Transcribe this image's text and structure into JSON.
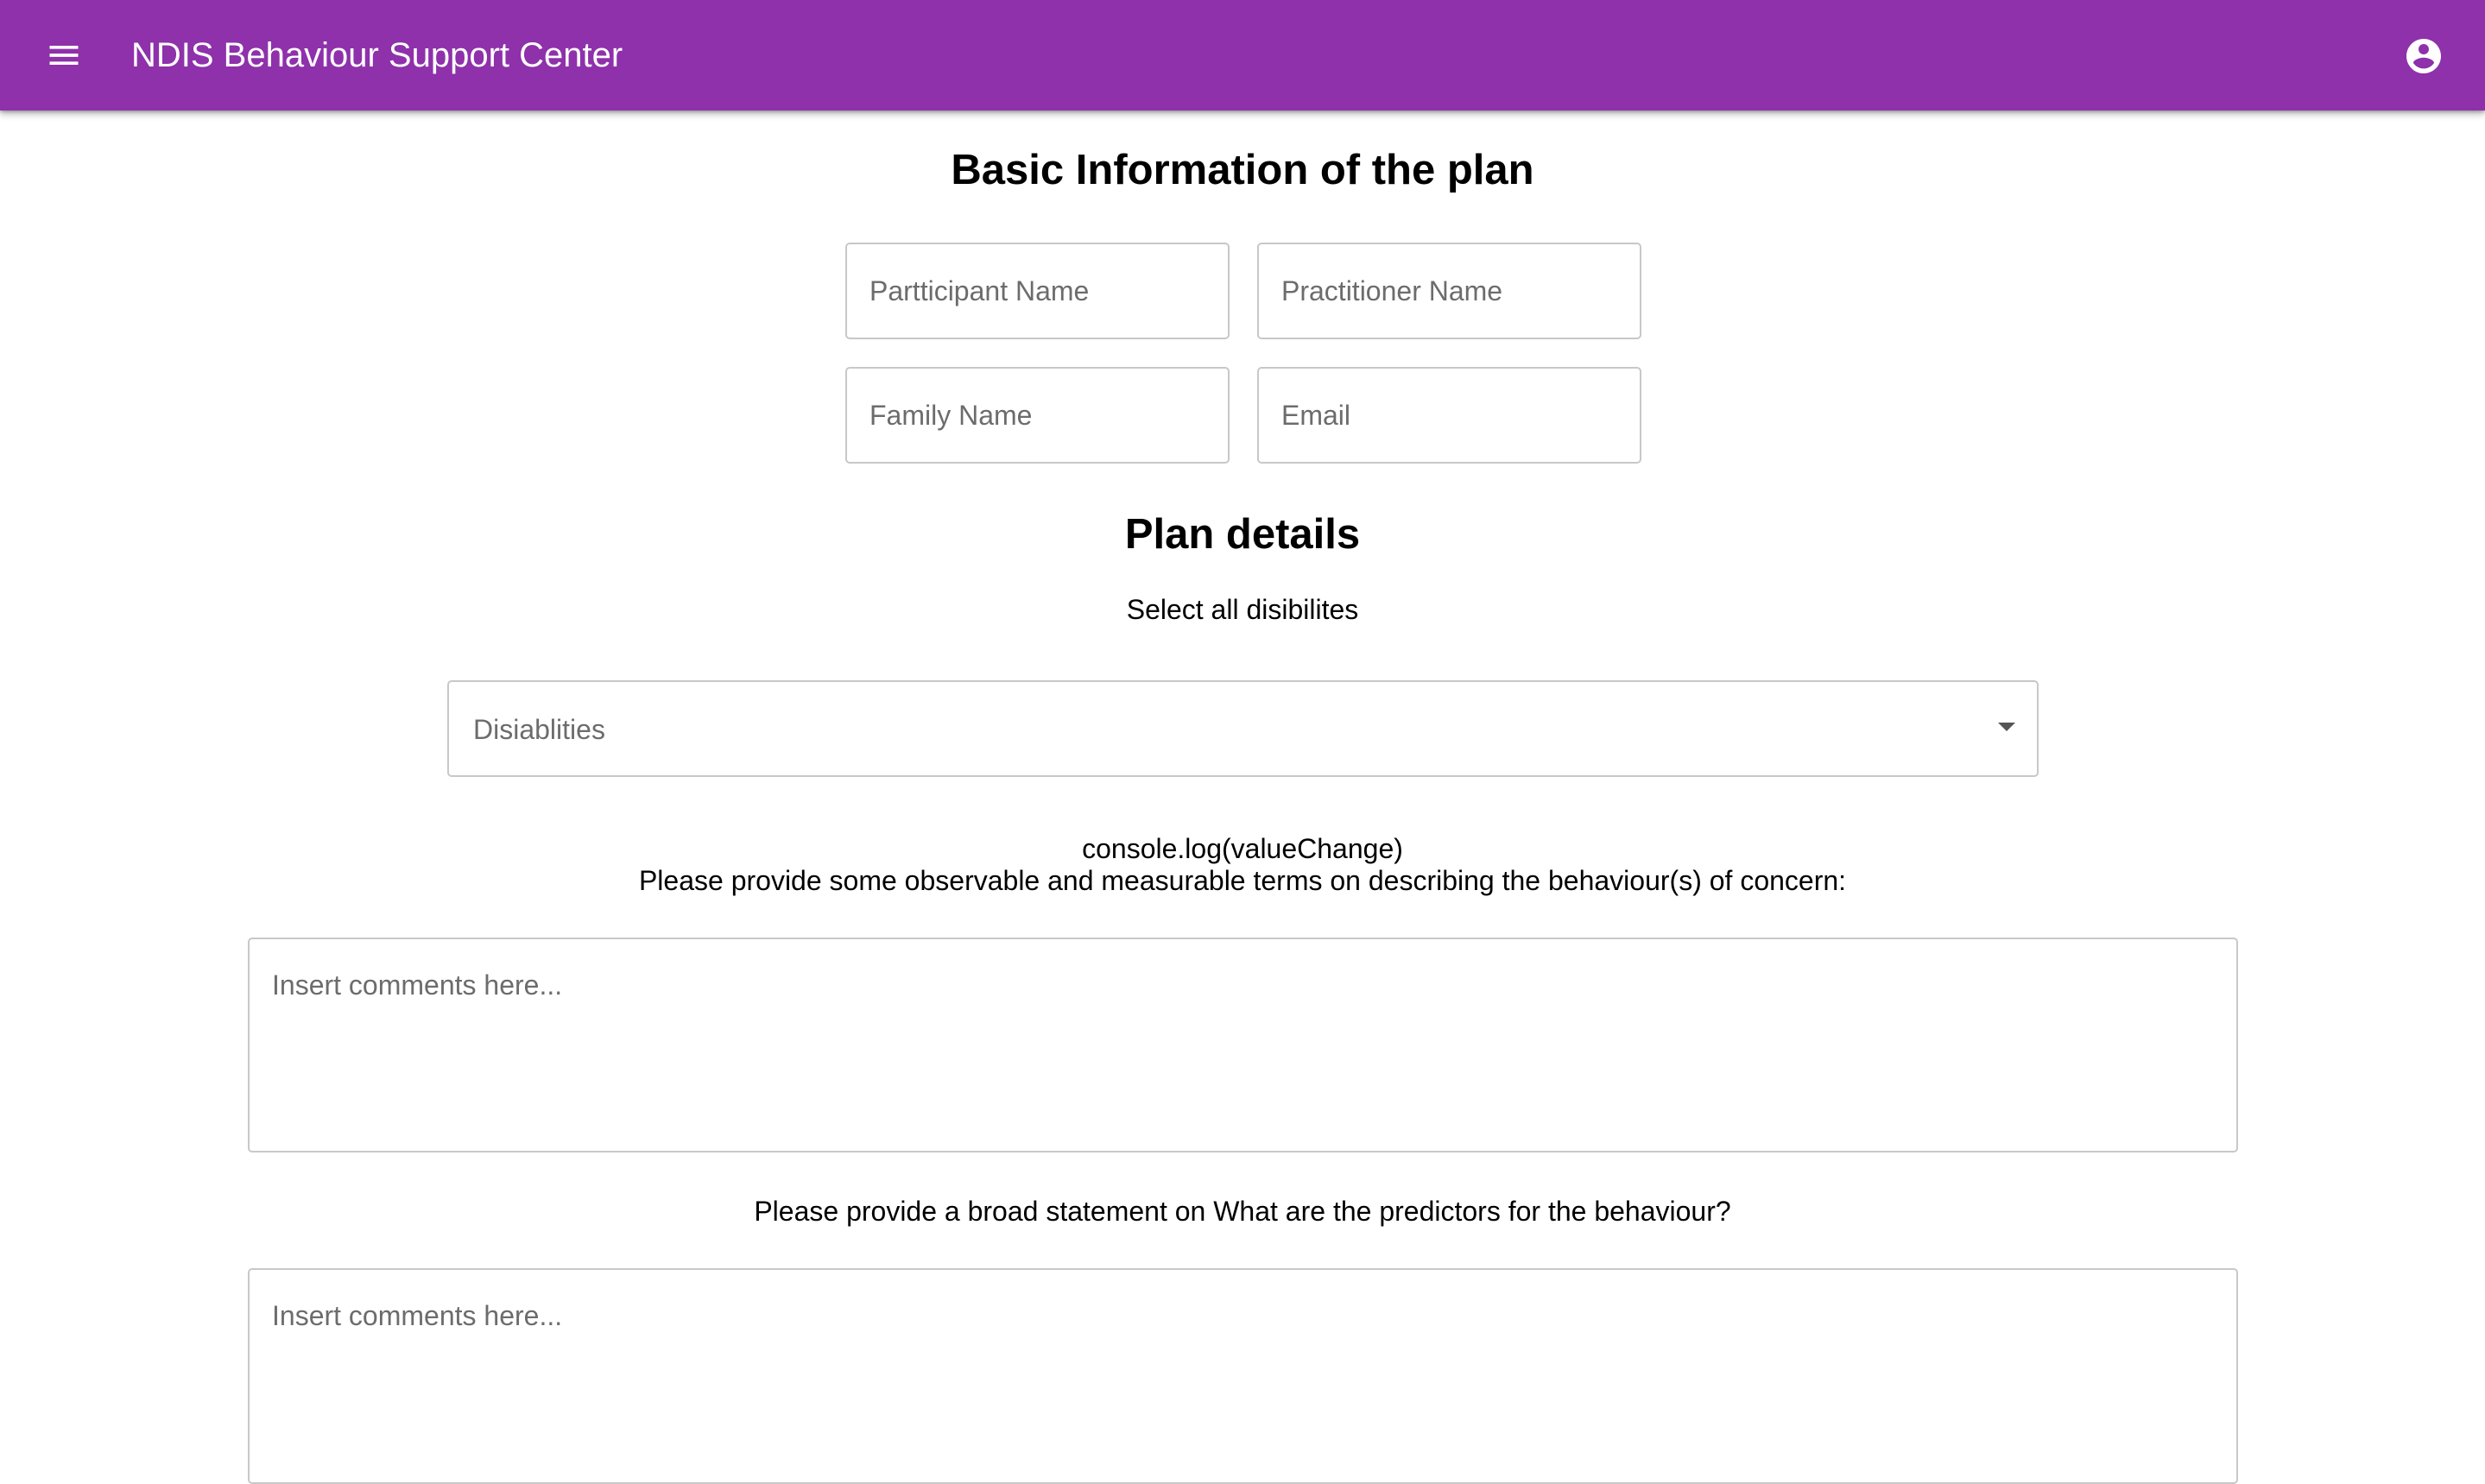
{
  "app_bar": {
    "title": "NDIS Behaviour Support Center",
    "background_color": "#8e31ab",
    "menu_icon": "menu-icon",
    "account_icon": "account-circle-icon"
  },
  "basic_info": {
    "heading": "Basic Information of the plan",
    "participant_name": {
      "placeholder": "Partticipant Name",
      "value": ""
    },
    "practitioner_name": {
      "placeholder": "Practitioner Name",
      "value": ""
    },
    "family_name": {
      "placeholder": "Family Name",
      "value": ""
    },
    "email": {
      "placeholder": "Email",
      "value": ""
    }
  },
  "plan_details": {
    "heading": "Plan details",
    "select_caption": "Select all disibilites",
    "disabilities_select": {
      "placeholder": "Disiablities",
      "icon": "arrow-drop-down-icon"
    },
    "debug_text": "console.log(valueChange)",
    "behaviour_prompt": "Please provide some observable and measurable terms on describing the behaviour(s) of concern:",
    "behaviour_comments": {
      "placeholder": "Insert comments here...",
      "value": ""
    },
    "predictors_prompt": "Please provide a broad statement on What are the predictors for the behaviour?",
    "predictors_comments": {
      "placeholder": "Insert comments here...",
      "value": ""
    }
  }
}
